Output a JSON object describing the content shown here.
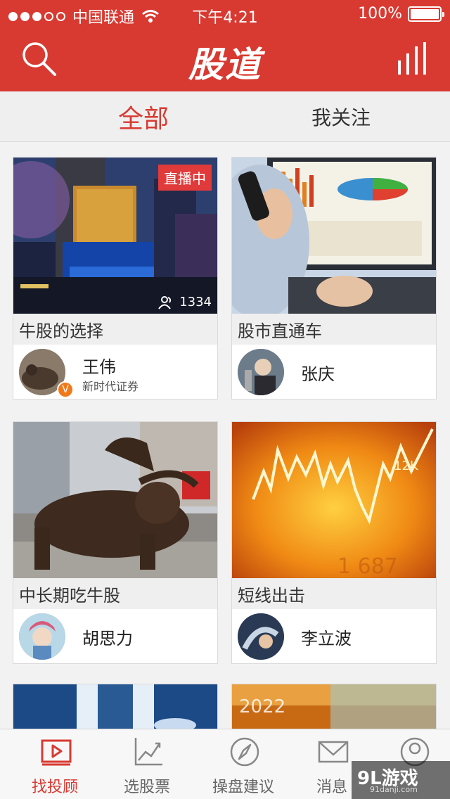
{
  "status_bar": {
    "carrier": "中国联通",
    "time": "下午4:21",
    "battery": "100%"
  },
  "navbar": {
    "title": "股道",
    "search_icon": "search-icon",
    "chart_icon": "bar-chart-icon"
  },
  "tabs": [
    {
      "label": "全部",
      "active": true
    },
    {
      "label": "我关注",
      "active": false
    }
  ],
  "cards": [
    {
      "title": "牛股的选择",
      "author": "王伟",
      "org": "新时代证券",
      "live": "直播中",
      "viewers": "1334",
      "verified": "V"
    },
    {
      "title": "股市直通车",
      "author": "张庆"
    },
    {
      "title": "中长期吃牛股",
      "author": "胡思力"
    },
    {
      "title": "短线出击",
      "author": "李立波"
    }
  ],
  "tabbar": [
    {
      "label": "找投顾",
      "icon": "play-box-icon",
      "active": true
    },
    {
      "label": "选股票",
      "icon": "line-chart-icon",
      "active": false
    },
    {
      "label": "操盘建议",
      "icon": "compass-icon",
      "active": false
    },
    {
      "label": "消息",
      "icon": "mail-icon",
      "active": false
    },
    {
      "label": "",
      "icon": "user-icon",
      "active": false
    }
  ],
  "watermark": {
    "logo": "9L游戏",
    "url": "91danji.com"
  },
  "colors": {
    "brand": "#d83a32",
    "badge": "#f07a1a"
  }
}
